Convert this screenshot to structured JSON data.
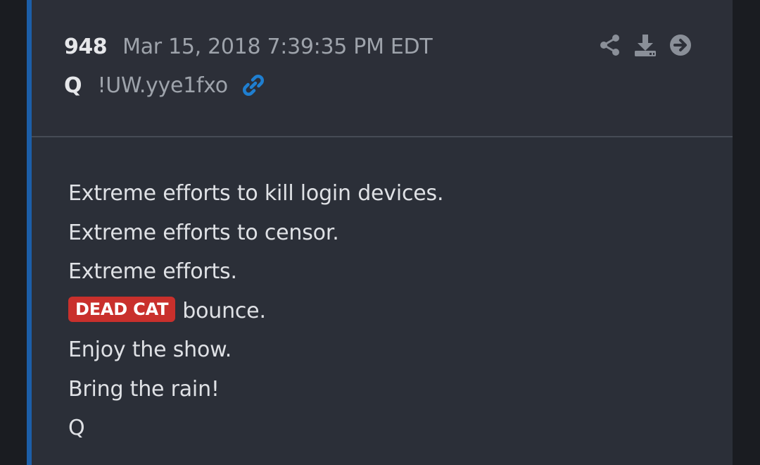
{
  "post": {
    "number": "948",
    "date": "Mar 15, 2018 7:39:35 PM EDT",
    "author": "Q",
    "tripcode": "!UW.yye1fxo"
  },
  "icons": {
    "link": "link-icon",
    "share": "share-icon",
    "download": "download-icon",
    "next": "arrow-right-circle-icon"
  },
  "colors": {
    "accent": "#1c5ea8",
    "link": "#1f7fd1",
    "badge": "#c9302c"
  },
  "message": {
    "line1": "Extreme efforts to kill login devices.",
    "line2": "Extreme efforts to censor.",
    "line3": "Extreme efforts.",
    "badge": "DEAD CAT",
    "line4": "bounce.",
    "line5": "Enjoy the show.",
    "line6": "Bring the rain!",
    "signature": "Q"
  }
}
